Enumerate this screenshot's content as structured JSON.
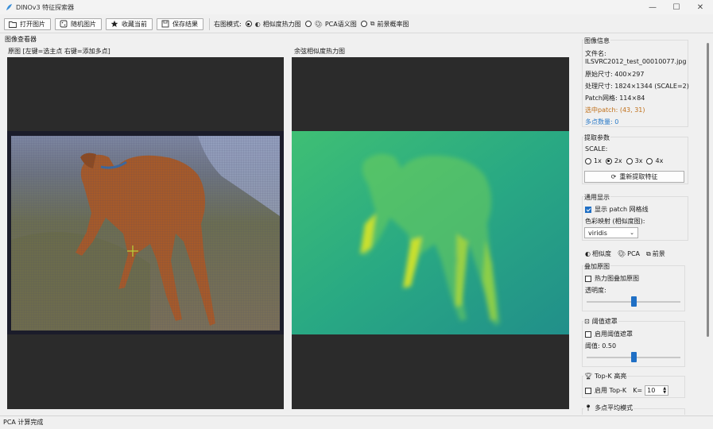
{
  "window": {
    "title": "DINOv3 特征探索器",
    "minimize": "—",
    "maximize": "☐",
    "close": "✕"
  },
  "toolbar": {
    "open_label": "打开图片",
    "random_label": "随机图片",
    "favorite_label": "收藏当前",
    "save_label": "保存结果",
    "mode_label": "右图模式:",
    "modes": [
      {
        "label": "相似度热力图",
        "selected": true
      },
      {
        "label": "PCA语义图",
        "selected": false
      },
      {
        "label": "前景概率图",
        "selected": false
      }
    ]
  },
  "viewer": {
    "group_title": "图像查看器",
    "left_label": "原图  [左键=选主点  右键=添加多点]",
    "right_label": "余弦相似度热力图"
  },
  "info": {
    "title": "图像信息",
    "filename_label": "文件名:",
    "filename": "ILSVRC2012_test_00010077.jpg",
    "original_size": "原始尺寸: 400×297",
    "processed_size": "处理尺寸: 1824×1344  (SCALE=2)",
    "patch_grid": "Patch网格: 114×84",
    "selected_patch": "选中patch: (43, 31)",
    "multi_count": "多点数量: 0",
    "selected_color": "#c0701a",
    "multi_color": "#2a7ac8"
  },
  "extract": {
    "title": "提取参数",
    "scale_label": "SCALE:",
    "scales": [
      {
        "label": "1x",
        "selected": false
      },
      {
        "label": "2x",
        "selected": true
      },
      {
        "label": "3x",
        "selected": false
      },
      {
        "label": "4x",
        "selected": false
      }
    ],
    "reextract_label": "重新提取特征"
  },
  "display": {
    "title": "通用显示",
    "show_grid_label": "显示 patch 网格线",
    "show_grid_checked": true,
    "colormap_label": "色彩映射 (相似度图):",
    "colormap_value": "viridis"
  },
  "tabs": {
    "items": [
      "相似度",
      "PCA",
      "前景"
    ]
  },
  "overlay": {
    "title": "叠加原图",
    "checkbox_label": "热力图叠加原图",
    "opacity_label": "透明度:",
    "opacity_value": 0.5
  },
  "threshold": {
    "title": "阈值遮罩",
    "checkbox_label": "启用阈值遮罩",
    "value_label": "阈值: 0.50",
    "value": 0.5
  },
  "topk": {
    "title": "Top-K 高亮",
    "checkbox_label": "启用 Top-K",
    "k_label": "K=",
    "k_value": "10"
  },
  "multi": {
    "title": "多点平均模式"
  },
  "status": {
    "text": "PCA 计算完成"
  }
}
